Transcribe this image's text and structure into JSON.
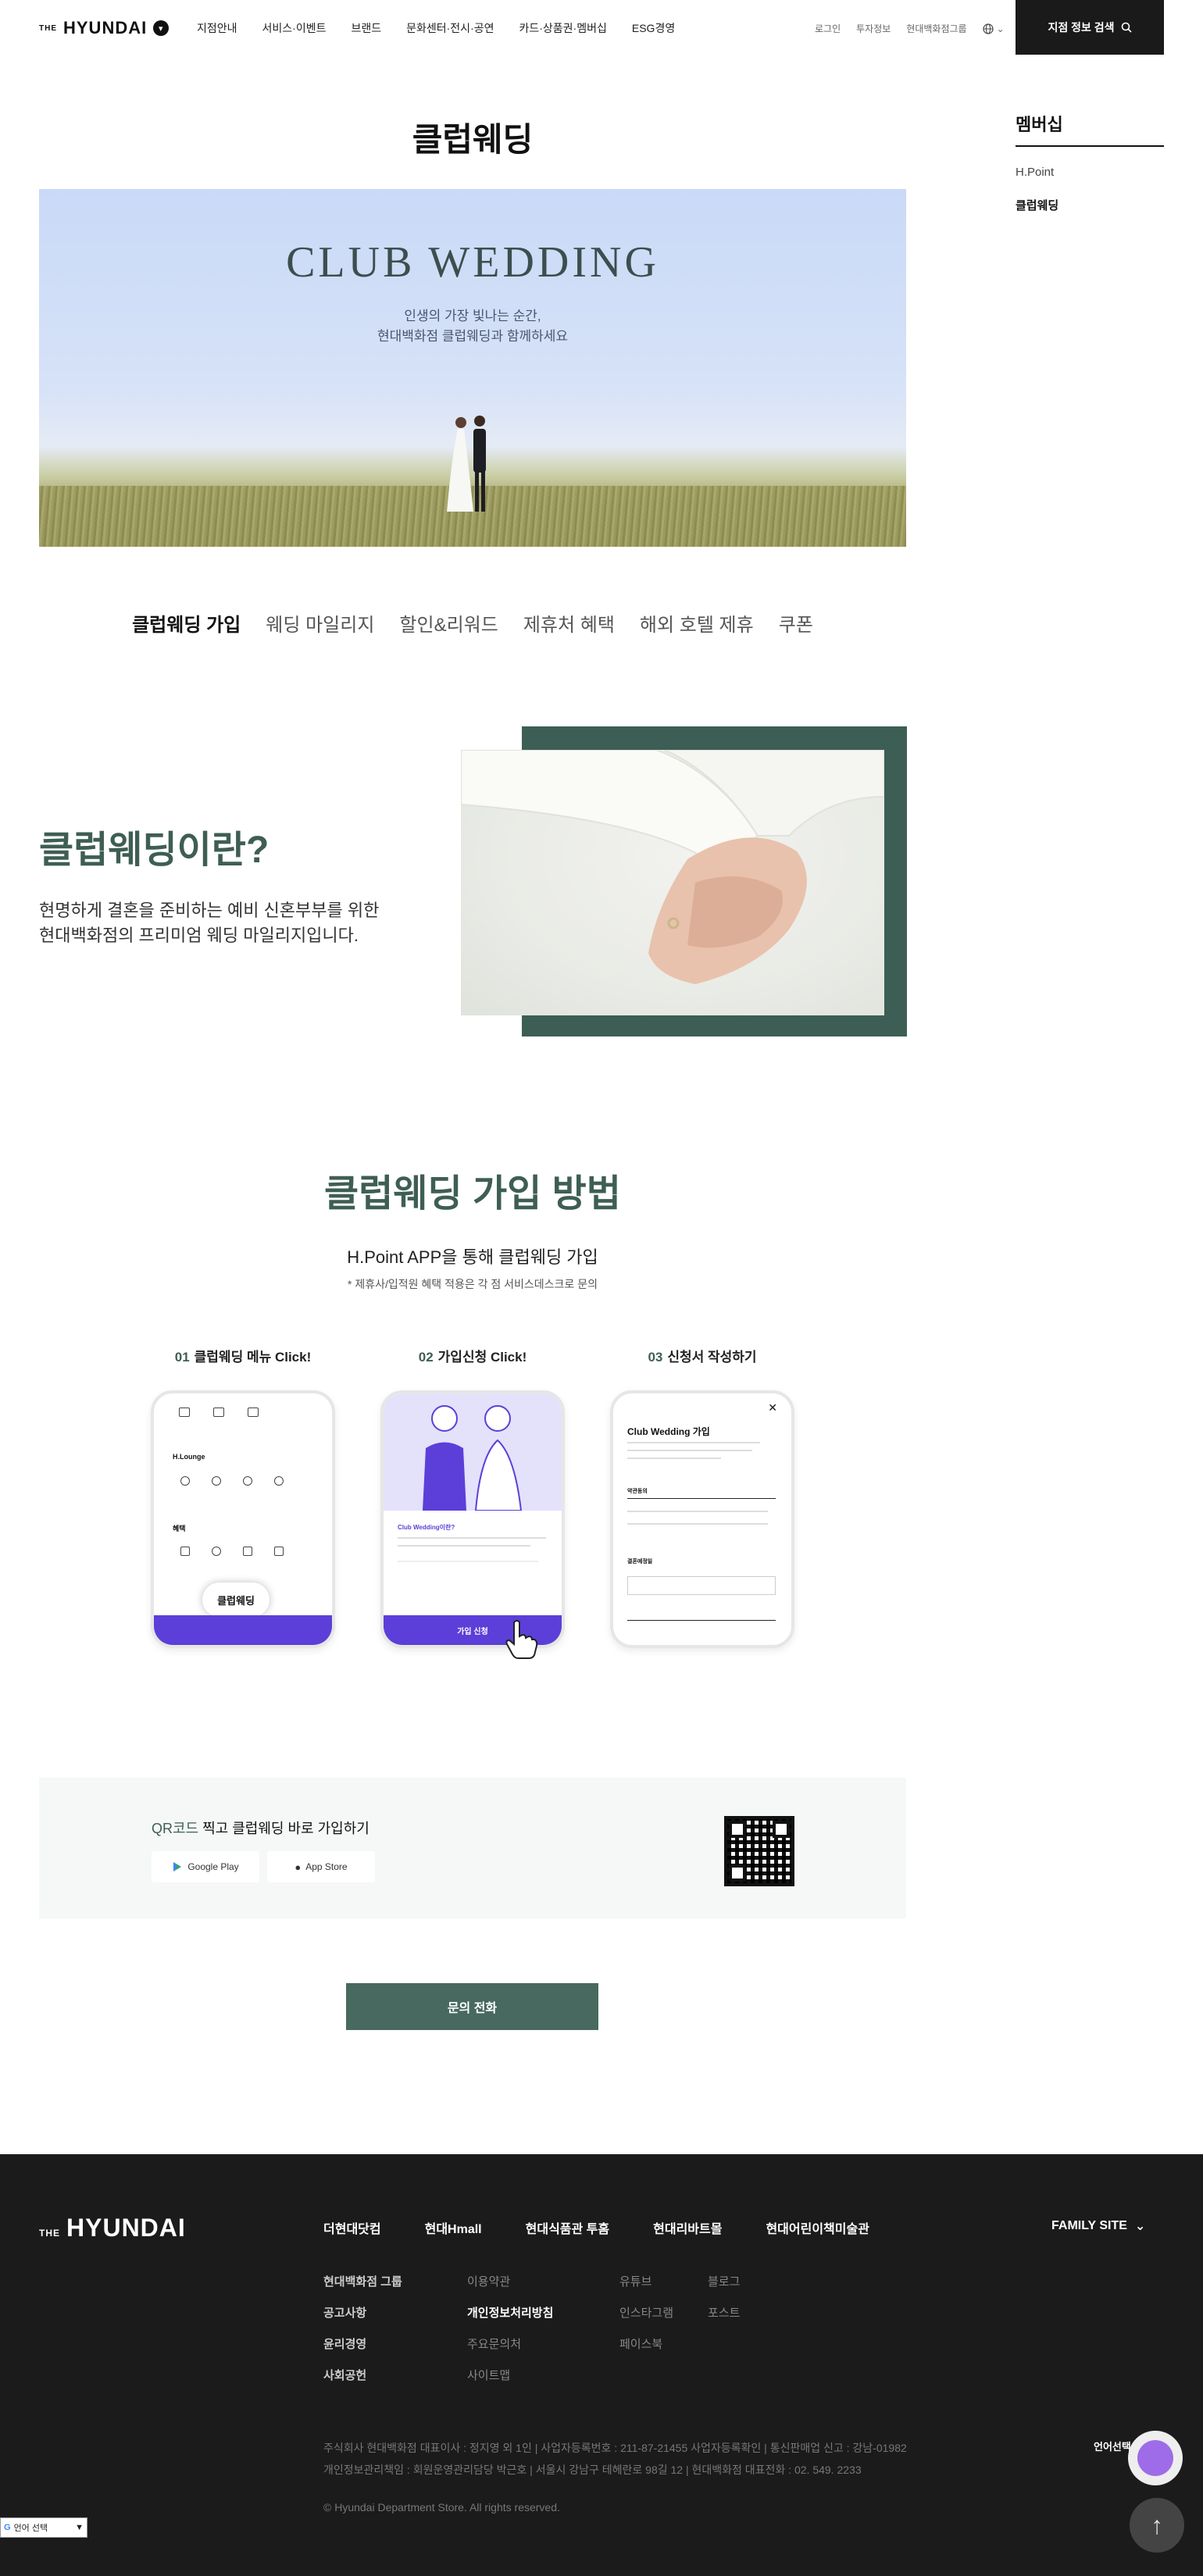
{
  "header": {
    "logo_small": "THE",
    "logo_main": "HYUNDAI",
    "nav": [
      "지점안내",
      "서비스·이벤트",
      "브랜드",
      "문화센터·전시·공연",
      "카드·상품권·멤버십",
      "ESG경영"
    ],
    "util": [
      "로그인",
      "투자정보",
      "현대백화점그룹"
    ],
    "store_search": "지점 정보 검색"
  },
  "side": {
    "title": "멤버십",
    "items": [
      "H.Point",
      "클럽웨딩"
    ]
  },
  "page_title": "클럽웨딩",
  "hero": {
    "title": "CLUB WEDDING",
    "line1": "인생의 가장 빛나는 순간,",
    "line2": "현대백화점 클럽웨딩과 함께하세요"
  },
  "tabs": [
    "클럽웨딩 가입",
    "웨딩 마일리지",
    "할인&리워드",
    "제휴처 혜택",
    "해외 호텔 제휴",
    "쿠폰"
  ],
  "intro": {
    "title": "클럽웨딩이란?",
    "desc1": "현명하게 결혼을 준비하는 예비 신혼부부를 위한",
    "desc2": "현대백화점의 프리미엄 웨딩 마일리지입니다."
  },
  "join": {
    "title": "클럽웨딩 가입 방법",
    "sub": "H.Point APP을 통해 클럽웨딩 가입",
    "note": "* 제휴사/입적원 혜택 적용은 각 점 서비스데스크로 문의",
    "steps": [
      {
        "num": "01",
        "label": "클럽웨딩 메뉴 Click!"
      },
      {
        "num": "02",
        "label": "가입신청 Click!"
      },
      {
        "num": "03",
        "label": "신청서 작성하기"
      }
    ],
    "phone1": {
      "section1": "H.Lounge",
      "section2": "혜택",
      "chip": "클럽웨딩"
    },
    "phone2": {
      "card_title": "Club Wedding이란?",
      "button": "가입 신청"
    },
    "phone3": {
      "title": "Club Wedding 가입",
      "field1": "약관동의",
      "field2": "결혼예정일"
    }
  },
  "qr": {
    "title_hl": "QR코드",
    "title_rest": " 찍고 클럽웨딩 바로 가입하기",
    "google": "Google Play",
    "apple": "App Store"
  },
  "inquiry_button": "문의 전화",
  "footer": {
    "logo_small": "THE",
    "logo_main": "HYUNDAI",
    "brands": [
      "더현대닷컴",
      "현대Hmall",
      "현대식품관 투홈",
      "현대리바트몰",
      "현대어린이책미술관"
    ],
    "family_site": "FAMILY SITE",
    "col1": [
      "현대백화점 그룹",
      "공고사항",
      "윤리경영",
      "사회공헌"
    ],
    "col2": [
      "이용약관",
      "개인정보처리방침",
      "주요문의처",
      "사이트맵"
    ],
    "col3": [
      "유튜브",
      "인스타그램",
      "페이스북"
    ],
    "col4": [
      "블로그",
      "포스트"
    ],
    "info1": "주식회사 현대백화점 대표이사 : 정지영 외 1인  |  사업자등록번호 : 211-87-21455 사업자등록확인  |  통신판매업 신고 : 강남-01982",
    "info2": "개인정보관리책임 : 회원운영관리담당 박근호  |  서울시 강남구 테헤란로 98길 12  |  현대백화점 대표전화 : 02. 549. 2233",
    "copyright": "© Hyundai Department Store. All rights reserved.",
    "language_label": "언어선택",
    "translate_widget": "언어 선택"
  }
}
